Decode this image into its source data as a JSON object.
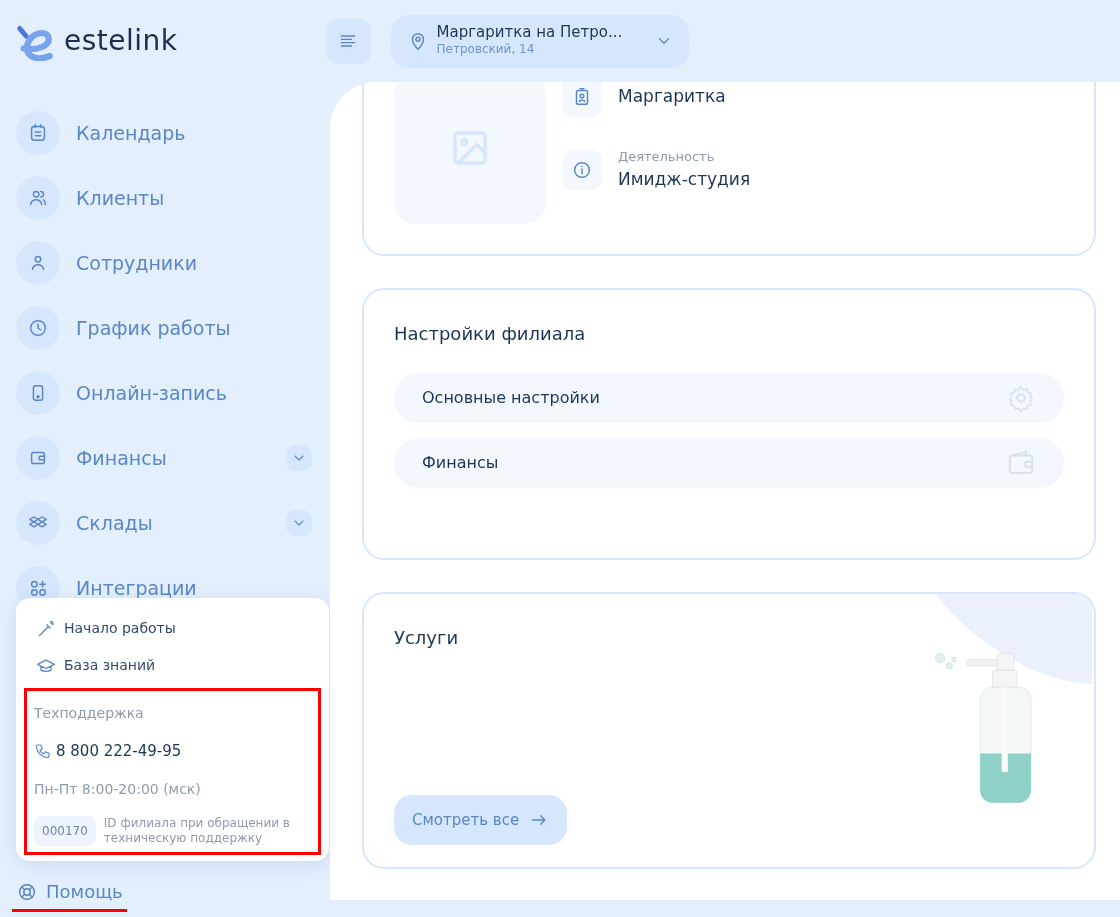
{
  "logo": {
    "text": "estelink"
  },
  "branch_selector": {
    "name": "Маргаритка на Петро...",
    "address": "Петровский, 14"
  },
  "sidebar": {
    "items": [
      {
        "label": "Календарь",
        "has_submenu": false
      },
      {
        "label": "Клиенты",
        "has_submenu": false
      },
      {
        "label": "Сотрудники",
        "has_submenu": false
      },
      {
        "label": "График работы",
        "has_submenu": false
      },
      {
        "label": "Онлайн-запись",
        "has_submenu": false
      },
      {
        "label": "Финансы",
        "has_submenu": true
      },
      {
        "label": "Склады",
        "has_submenu": true
      },
      {
        "label": "Интеграции",
        "has_submenu": false
      }
    ]
  },
  "help_menu": {
    "items": [
      {
        "label": "Начало работы"
      },
      {
        "label": "База знаний"
      }
    ],
    "support": {
      "title": "Техподдержка",
      "phone": "8 800 222-49-95",
      "hours": "Пн-Пт 8:00-20:00 (мск)",
      "branch_id": "000170",
      "id_note": "ID филиала при обращении в техническую поддержку",
      "highlighted": true
    }
  },
  "help_button": {
    "label": "Помощь",
    "underlined": true
  },
  "branch_card": {
    "fields": [
      {
        "value": "Маргаритка"
      },
      {
        "label": "Деятельность",
        "value": "Имидж-студия"
      }
    ]
  },
  "settings_card": {
    "title": "Настройки филиала",
    "items": [
      {
        "label": "Основные настройки"
      },
      {
        "label": "Финансы"
      }
    ]
  },
  "services_card": {
    "title": "Услуги",
    "button": "Смотреть все"
  }
}
